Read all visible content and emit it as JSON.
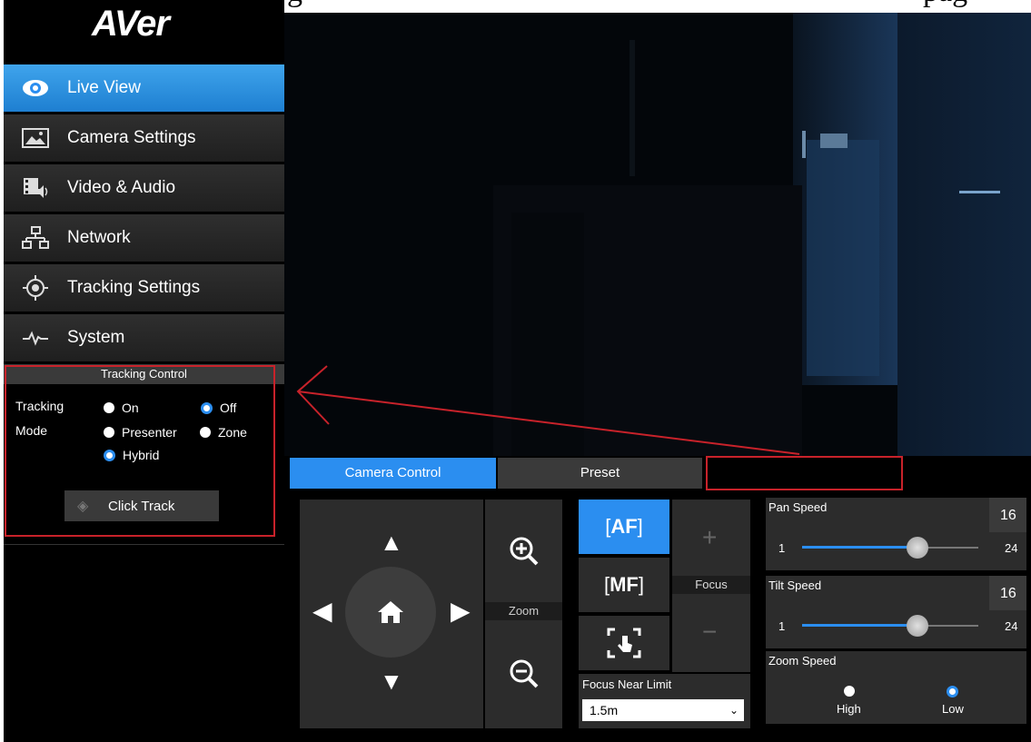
{
  "brand": {
    "logo_text": "AVer"
  },
  "page_header_fragment_left": "g",
  "page_header_fragment_right": "pag",
  "sidebar": {
    "items": [
      {
        "label": "Live View",
        "icon": "eye-icon",
        "active": true
      },
      {
        "label": "Camera Settings",
        "icon": "image-icon",
        "active": false
      },
      {
        "label": "Video & Audio",
        "icon": "film-audio-icon",
        "active": false
      },
      {
        "label": "Network",
        "icon": "network-icon",
        "active": false
      },
      {
        "label": "Tracking Settings",
        "icon": "target-icon",
        "active": false
      },
      {
        "label": "System",
        "icon": "pulse-icon",
        "active": false
      }
    ]
  },
  "tracking_control": {
    "title": "Tracking Control",
    "tracking_label": "Tracking",
    "mode_label": "Mode",
    "tracking_options": [
      {
        "label": "On",
        "checked": false
      },
      {
        "label": "Off",
        "checked": true
      }
    ],
    "mode_options": [
      {
        "label": "Presenter",
        "checked": false
      },
      {
        "label": "Zone",
        "checked": false
      },
      {
        "label": "Hybrid",
        "checked": true
      }
    ],
    "click_track_label": "Click Track"
  },
  "tabs": [
    {
      "label": "Camera Control",
      "active": true
    },
    {
      "label": "Preset",
      "active": false
    }
  ],
  "camera_control": {
    "zoom_label": "Zoom",
    "focus_label": "Focus",
    "af_label": "AF",
    "mf_label": "MF",
    "focus_near_limit_label": "Focus Near Limit",
    "focus_near_limit_value": "1.5m"
  },
  "pan_speed": {
    "label": "Pan Speed",
    "value": "16",
    "min": "1",
    "max": "24",
    "level": 16
  },
  "tilt_speed": {
    "label": "Tilt Speed",
    "value": "16",
    "min": "1",
    "max": "24",
    "level": 16
  },
  "zoom_speed": {
    "label": "Zoom Speed",
    "options": [
      {
        "label": "High",
        "checked": false
      },
      {
        "label": "Low",
        "checked": true
      }
    ]
  },
  "colors": {
    "accent": "#2b8ef0",
    "annotation": "#c8222a"
  }
}
